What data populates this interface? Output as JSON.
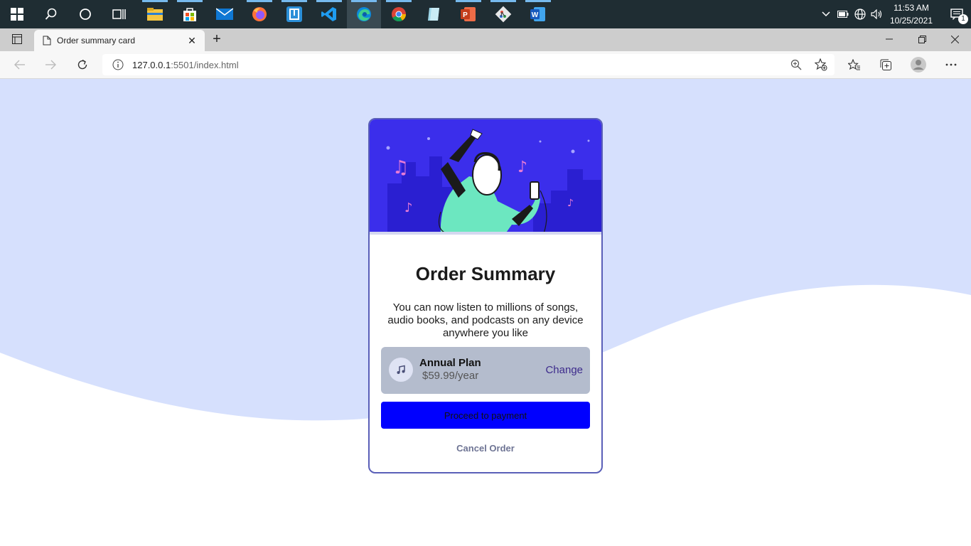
{
  "taskbar": {
    "clock_time": "11:53 AM",
    "clock_date": "10/25/2021",
    "notification_count": "1",
    "apps": [
      "start",
      "search",
      "cortana",
      "task-view",
      "file-explorer",
      "store",
      "mail",
      "firefox",
      "app-unknown",
      "vscode",
      "edge",
      "chrome",
      "app-tablet",
      "powerpoint",
      "git",
      "word"
    ]
  },
  "browser": {
    "tab_title": "Order summary card",
    "url_host": "127.0.0.1",
    "url_path": ":5501/index.html"
  },
  "card": {
    "title": "Order Summary",
    "description": "You can now listen to millions of songs, audio books, and podcasts on any device anywhere you like",
    "plan_name": "Annual Plan",
    "plan_price": "$59.99/year",
    "plan_change": "Change",
    "pay_button": "Proceed to payment",
    "cancel": "Cancel Order"
  },
  "colors": {
    "page_bg_pattern": "#d6e0fd",
    "hero_bg": "#3b2eeb",
    "pay_button": "#0000ff",
    "plan_box": "#b4bccd",
    "card_border": "#5a5fb8"
  }
}
